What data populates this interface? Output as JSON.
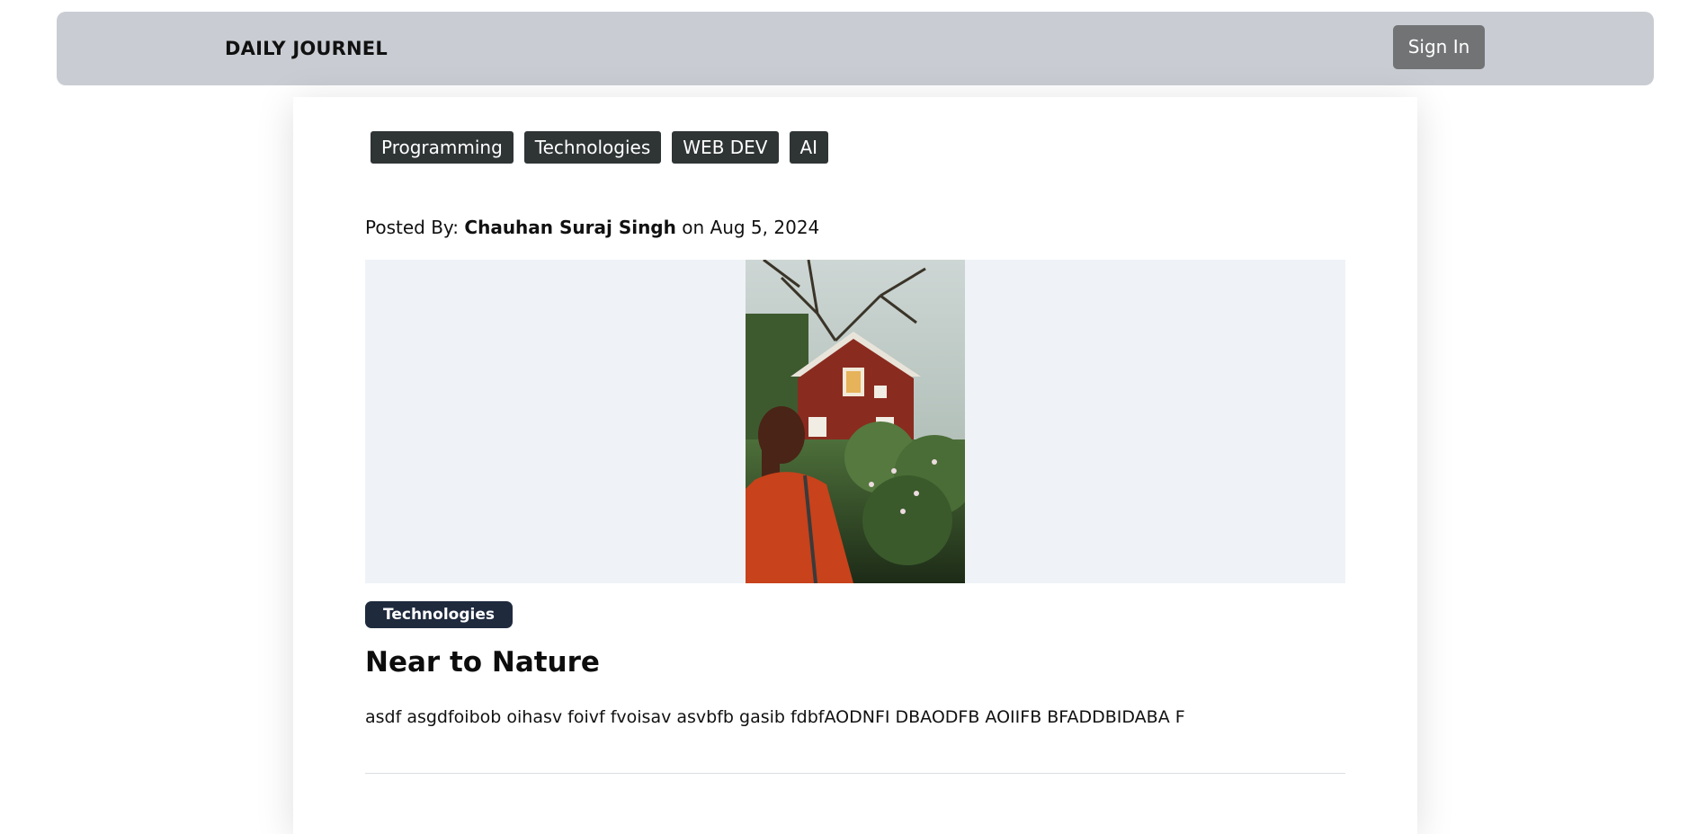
{
  "header": {
    "brand": "DAILY JOURNEL",
    "sign_in_label": "Sign In"
  },
  "categories": [
    {
      "label": "Programming"
    },
    {
      "label": "Technologies"
    },
    {
      "label": "WEB DEV"
    },
    {
      "label": "AI"
    }
  ],
  "post": {
    "posted_by_label": "Posted By:",
    "author": "Chauhan Suraj Singh",
    "date_prefix": "on",
    "date": "Aug 5, 2024",
    "category_badge": "Technologies",
    "title": "Near to Nature",
    "excerpt": "asdf asgdfoibob oihasv foivf fvoisav asvbfb gasib fdbfAODNFI DBAODFB AOIIFB BFADDBIDABA F"
  },
  "colors": {
    "navbar_bg": "#c9cdd3",
    "signin_bg": "#727375",
    "category_tag_bg": "#2f3435",
    "badge_bg": "#1f2a3d",
    "image_frame_bg": "#eff3f7"
  }
}
